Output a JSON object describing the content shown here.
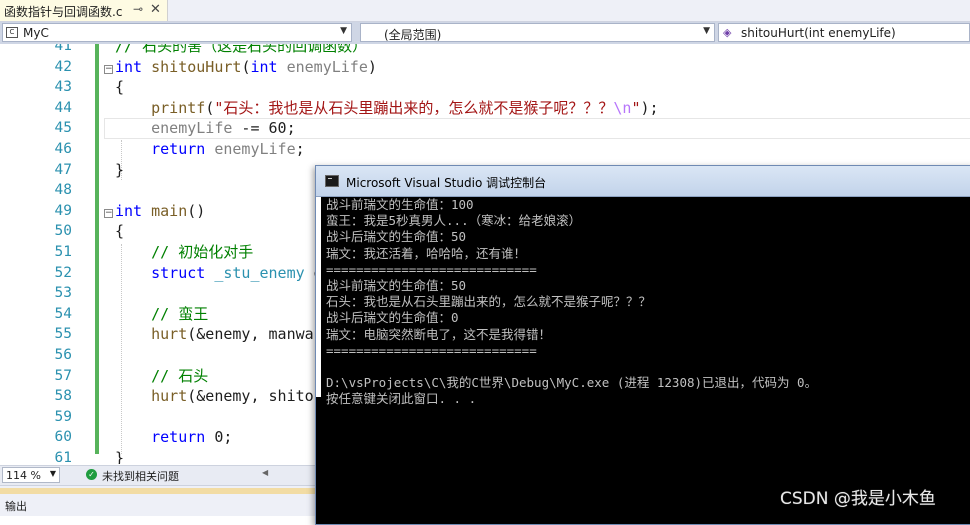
{
  "tab": {
    "title": "函数指针与回调函数.c",
    "pin_icon": "pin-icon",
    "close_glyph": "✕"
  },
  "navbar": {
    "project": "MyC",
    "scope": "(全局范围)",
    "function": "shitouHurt(int enemyLife)"
  },
  "editor": {
    "line_numbers": [
      "41",
      "42",
      "43",
      "44",
      "45",
      "46",
      "47",
      "48",
      "49",
      "50",
      "51",
      "52",
      "53",
      "54",
      "55",
      "56",
      "57",
      "58",
      "59",
      "60",
      "61"
    ],
    "zoom": "114 %",
    "issues_text": "未找到相关问题"
  },
  "output_panel": {
    "title": "输出"
  },
  "console": {
    "title": "Microsoft Visual Studio 调试控制台",
    "lines": [
      "战斗前瑞文的生命值：100",
      "蛮王：我是5秒真男人...（寒冰：给老娘滚）",
      "战斗后瑞文的生命值：50",
      "瑞文：我还活着，哈哈哈，还有谁！",
      "============================",
      "战斗前瑞文的生命值：50",
      "石头：我也是从石头里蹦出来的，怎么就不是猴子呢？？？",
      "战斗后瑞文的生命值：0",
      "瑞文：电脑突然断电了，这不是我得错！",
      "============================",
      "",
      "D:\\vsProjects\\C\\我的C世界\\Debug\\MyC.exe (进程 12308)已退出，代码为 0。",
      "按任意键关闭此窗口. . ."
    ]
  },
  "watermark": "CSDN @我是小木鱼"
}
